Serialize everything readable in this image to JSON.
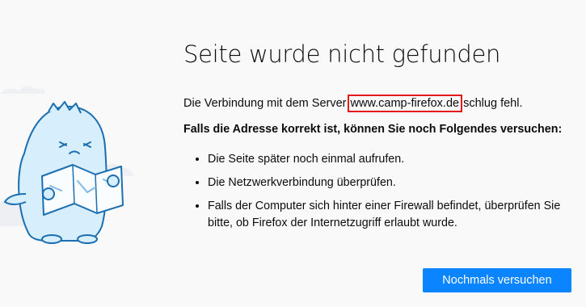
{
  "error_page": {
    "title": "Seite wurde nicht gefunden",
    "description_before": "Die Verbindung mit dem Server ",
    "server_name": "www.camp-firefox.de",
    "description_after": " schlug fehl.",
    "hint_heading": "Falls die Adresse korrekt ist, können Sie noch Folgendes versuchen:",
    "suggestions": [
      "Die Seite später noch einmal aufrufen.",
      "Die Netzwerkverbindung überprüfen.",
      "Falls der Computer sich hinter einer Firewall befindet, überprüfen Sie bitte, ob Firefox der Internetzugriff erlaubt wurde."
    ],
    "retry_button_label": "Nochmals versuchen"
  },
  "colors": {
    "background": "#f9f9fa",
    "primary_button": "#0a84ff",
    "highlight_box": "#e21a1a",
    "illustration_fill": "#d7eefc",
    "illustration_stroke": "#1b6fb1"
  },
  "icons": {
    "illustration": "dinosaur-with-map-illustration"
  }
}
